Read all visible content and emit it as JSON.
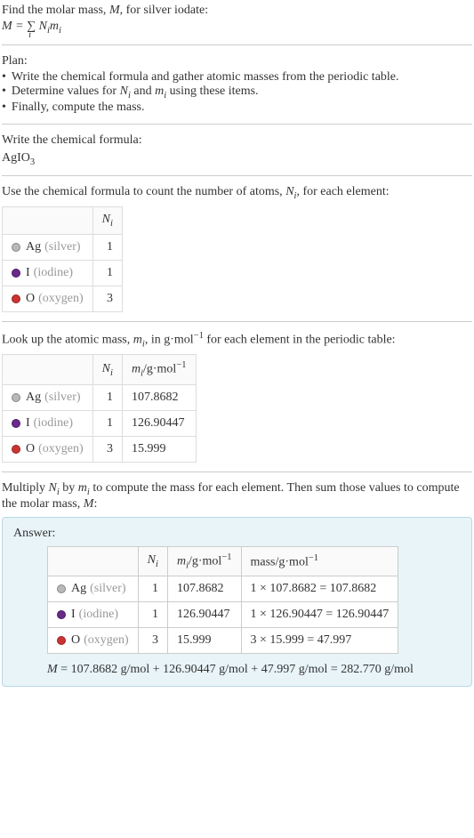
{
  "intro": {
    "line1": "Find the molar mass, ",
    "var_M": "M",
    "line1b": ", for silver iodate:",
    "eq_lhs": "M = ",
    "eq_sigma": "∑",
    "eq_sub": "i",
    "eq_rhs_N": "N",
    "eq_rhs_m": "m",
    "eq_i": "i"
  },
  "plan": {
    "title": "Plan:",
    "items": [
      "Write the chemical formula and gather atomic masses from the periodic table.",
      "Determine values for ",
      "Finally, compute the mass."
    ],
    "item2_mid": " and ",
    "item2_end": " using these items.",
    "N": "N",
    "m": "m",
    "i": "i"
  },
  "formula_sec": {
    "title": "Write the chemical formula:",
    "formula_main": "AgIO",
    "formula_sub": "3"
  },
  "count_sec": {
    "title_a": "Use the chemical formula to count the number of atoms, ",
    "N": "N",
    "i": "i",
    "title_b": ", for each element:",
    "header_Ni": "N",
    "rows": [
      {
        "sym": "Ag",
        "name": "(silver)",
        "dot": "dot-ag",
        "n": "1"
      },
      {
        "sym": "I",
        "name": "(iodine)",
        "dot": "dot-i",
        "n": "1"
      },
      {
        "sym": "O",
        "name": "(oxygen)",
        "dot": "dot-o",
        "n": "3"
      }
    ]
  },
  "mass_sec": {
    "title_a": "Look up the atomic mass, ",
    "m": "m",
    "i": "i",
    "title_b": ", in g·mol",
    "neg1": "−1",
    "title_c": " for each element in the periodic table:",
    "header_Ni": "N",
    "header_mi": "m",
    "header_unit": "/g·mol",
    "rows": [
      {
        "sym": "Ag",
        "name": "(silver)",
        "dot": "dot-ag",
        "n": "1",
        "m": "107.8682"
      },
      {
        "sym": "I",
        "name": "(iodine)",
        "dot": "dot-i",
        "n": "1",
        "m": "126.90447"
      },
      {
        "sym": "O",
        "name": "(oxygen)",
        "dot": "dot-o",
        "n": "3",
        "m": "15.999"
      }
    ]
  },
  "multiply_sec": {
    "text_a": "Multiply ",
    "N": "N",
    "i": "i",
    "text_b": " by ",
    "m": "m",
    "text_c": " to compute the mass for each element. Then sum those values to compute the molar mass, ",
    "M": "M",
    "text_d": ":"
  },
  "answer": {
    "label": "Answer:",
    "header_Ni": "N",
    "header_mi": "m",
    "header_unit": "/g·mol",
    "neg1": "−1",
    "header_mass": "mass/g·mol",
    "rows": [
      {
        "sym": "Ag",
        "name": "(silver)",
        "dot": "dot-ag",
        "n": "1",
        "m": "107.8682",
        "calc": "1 × 107.8682 = 107.8682"
      },
      {
        "sym": "I",
        "name": "(iodine)",
        "dot": "dot-i",
        "n": "1",
        "m": "126.90447",
        "calc": "1 × 126.90447 = 126.90447"
      },
      {
        "sym": "O",
        "name": "(oxygen)",
        "dot": "dot-o",
        "n": "3",
        "m": "15.999",
        "calc": "3 × 15.999 = 47.997"
      }
    ],
    "final_M": "M",
    "final_eq": " = 107.8682 g/mol + 126.90447 g/mol + 47.997 g/mol = 282.770 g/mol"
  }
}
